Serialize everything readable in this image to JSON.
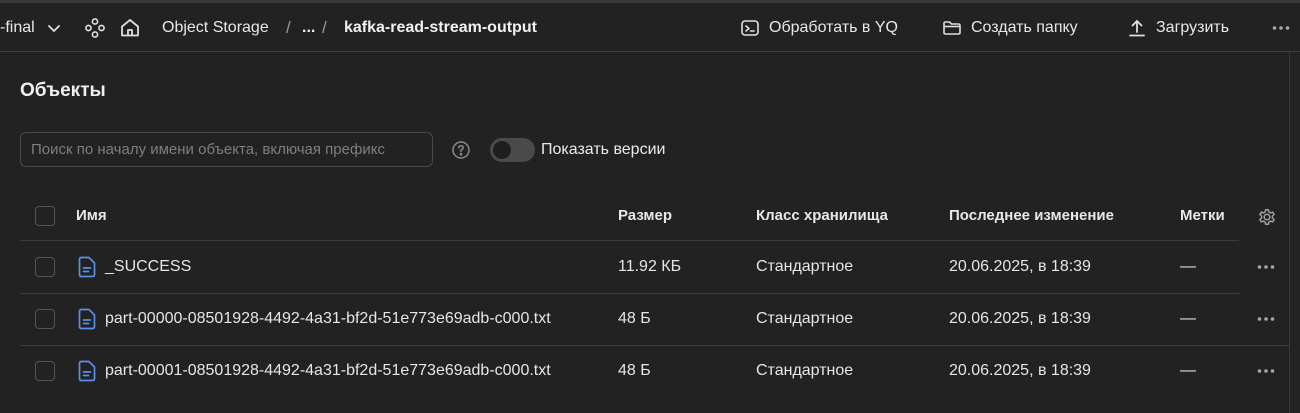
{
  "header": {
    "project_suffix": "-final",
    "breadcrumb": {
      "service": "Object Storage",
      "separator": "/",
      "ellipsis": "...",
      "current": "kafka-read-stream-output"
    },
    "actions": [
      {
        "label": "Обработать в YQ",
        "icon": "terminal-icon"
      },
      {
        "label": "Создать папку",
        "icon": "folder-icon"
      },
      {
        "label": "Загрузить",
        "icon": "upload-icon"
      }
    ],
    "more_icon": "more-horizontal-icon"
  },
  "page": {
    "title": "Объекты",
    "search_placeholder": "Поиск по началу имени объекта, включая префикс",
    "search_value": "",
    "show_versions_label": "Показать версии",
    "show_versions_enabled": false
  },
  "table": {
    "columns": [
      "Имя",
      "Размер",
      "Класс хранилища",
      "Последнее изменение",
      "Метки"
    ],
    "rows": [
      {
        "name": "_SUCCESS",
        "size": "11.92 КБ",
        "storage_class": "Стандартное",
        "modified": "20.06.2025, в 18:39",
        "labels": "—"
      },
      {
        "name": "part-00000-08501928-4492-4a31-bf2d-51e773e69adb-c000.txt",
        "size": "48 Б",
        "storage_class": "Стандартное",
        "modified": "20.06.2025, в 18:39",
        "labels": "—"
      },
      {
        "name": "part-00001-08501928-4492-4a31-bf2d-51e773e69adb-c000.txt",
        "size": "48 Б",
        "storage_class": "Стандартное",
        "modified": "20.06.2025, в 18:39",
        "labels": "—"
      }
    ]
  },
  "colors": {
    "background": "#222222",
    "file_icon": "#5b8fe8",
    "border": "#3d3d3d"
  }
}
